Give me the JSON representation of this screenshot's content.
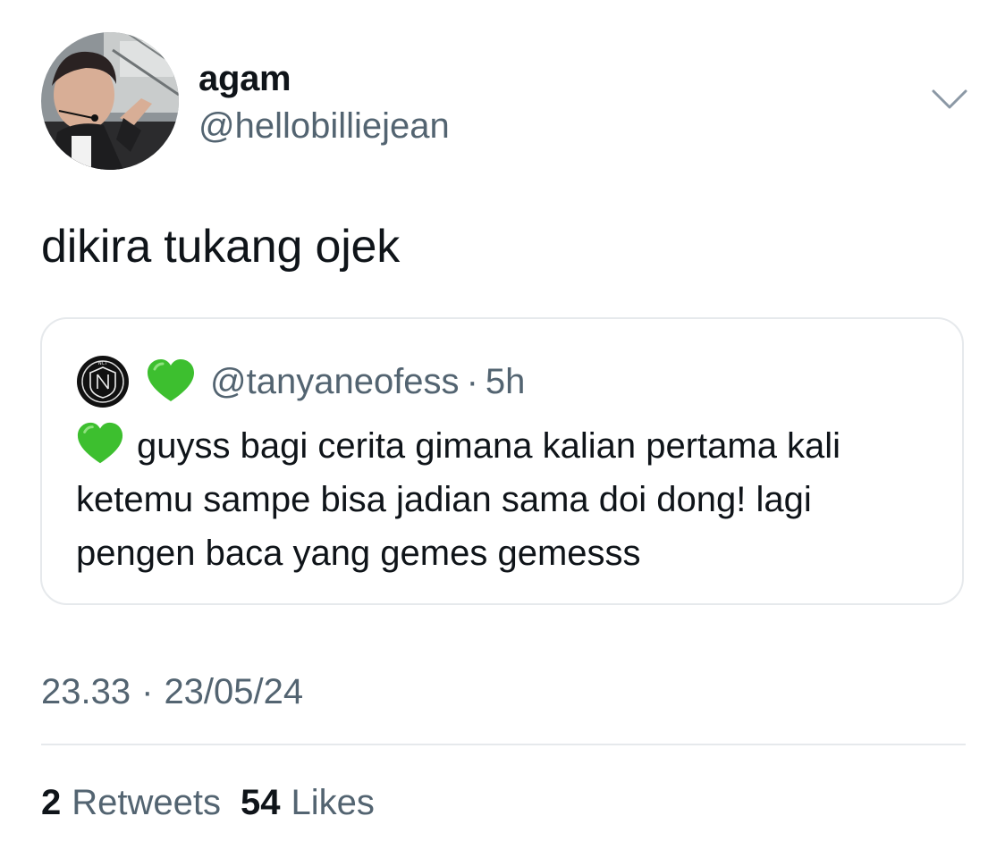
{
  "author": {
    "display_name": "agam",
    "handle": "@hellobilliejean"
  },
  "tweet": {
    "text": "dikira tukang ojek",
    "time": "23.33",
    "date": "23/05/24",
    "separator": "·"
  },
  "quote": {
    "handle": "@tanyaneofess",
    "separator": "·",
    "time": "5h",
    "text": "guyss bagi cerita gimana kalian pertama kali ketemu sampe bisa jadian sama doi dong! lagi pengen baca yang gemes gemesss",
    "emoji": "green-heart",
    "logo_label": "NCT"
  },
  "stats": {
    "retweets_count": "2",
    "retweets_label": "Retweets",
    "likes_count": "54",
    "likes_label": "Likes"
  },
  "icons": {
    "caret": "chevron-down-icon",
    "heart": "green-heart-icon"
  },
  "colors": {
    "text_primary": "#0f1419",
    "text_secondary": "#536471",
    "border": "#e6e9ec",
    "heart_green": "#3dbf2f"
  }
}
